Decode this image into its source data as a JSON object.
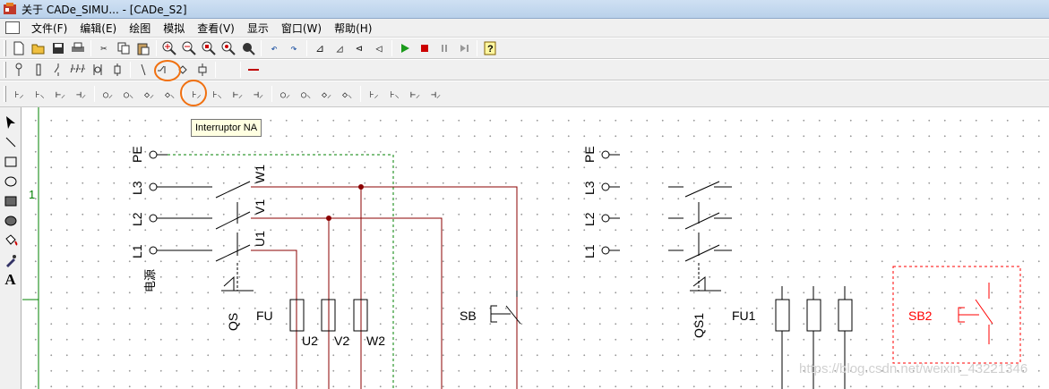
{
  "window": {
    "title": "关于 CADe_SIMU... - [CADe_S2]"
  },
  "menu": [
    "文件(F)",
    "编辑(E)",
    "绘图",
    "模拟",
    "查看(V)",
    "显示",
    "窗口(W)",
    "帮助(H)"
  ],
  "toolbar1": {
    "buttons": [
      "new-icon",
      "open-icon",
      "save-icon",
      "print-icon",
      "cut-icon",
      "copy-icon",
      "paste-icon",
      "zoom-in-icon",
      "zoom-out-icon",
      "zoom-window-icon",
      "zoom-all-icon",
      "pan-icon",
      "undo-icon",
      "redo-icon",
      "mirror-h-icon",
      "mirror-v-icon",
      "rotate-left-icon",
      "rotate-right-icon",
      "play-icon",
      "stop-icon",
      "pause-icon",
      "step-icon",
      "help-icon"
    ],
    "colors": {
      "play": "#1a9a1a",
      "stop": "#cc0000"
    }
  },
  "tooltip": "Interruptor NA",
  "sheet": {
    "row_number": "1"
  },
  "schematic": {
    "left": {
      "terminals": [
        "PE",
        "L3",
        "L2",
        "L1"
      ],
      "power_label": "电源",
      "breaker_phase_labels": [
        "W1",
        "V1",
        "U1"
      ],
      "breaker_label": "QS",
      "fuse_label": "FU",
      "fuse_outputs": [
        "U2",
        "V2",
        "W2"
      ],
      "button_label": "SB"
    },
    "right": {
      "terminals": [
        "PE",
        "L3",
        "L2",
        "L1"
      ],
      "breaker_label": "QS1",
      "fuse_label": "FU1",
      "button_label": "SB2"
    }
  },
  "watermark": "https://blog.csdn.net/weixin_43221346",
  "colors": {
    "wire": "#8b0000",
    "highlight": "#ff0000",
    "annotation": "#f07010",
    "dashed": "#008000"
  }
}
